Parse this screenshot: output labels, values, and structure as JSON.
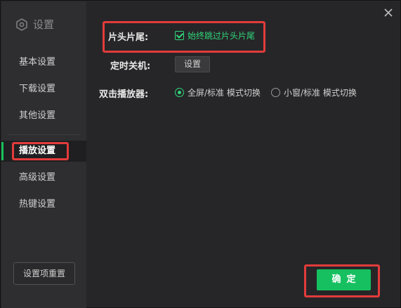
{
  "sidebar": {
    "title": "设置",
    "items": [
      {
        "label": "基本设置"
      },
      {
        "label": "下载设置"
      },
      {
        "label": "其他设置"
      },
      {
        "label": "播放设置"
      },
      {
        "label": "高级设置"
      },
      {
        "label": "热键设置"
      }
    ],
    "reset_label": "设置项重置"
  },
  "form": {
    "skip": {
      "label": "片头片尾:",
      "checkbox_label": "始终跳过片头片尾",
      "checked": true
    },
    "shutdown": {
      "label": "定时关机:",
      "button_label": "设置"
    },
    "dblclick": {
      "label": "双击播放器:",
      "options": [
        {
          "label": "全屏/标准 模式切换",
          "selected": true
        },
        {
          "label": "小窗/标准 模式切换",
          "selected": false
        }
      ]
    }
  },
  "footer": {
    "ok_label": "确定"
  },
  "colors": {
    "accent": "#17c15b",
    "highlight": "#e23b3b",
    "background": "#262628",
    "sidebar": "#2e2e30"
  }
}
